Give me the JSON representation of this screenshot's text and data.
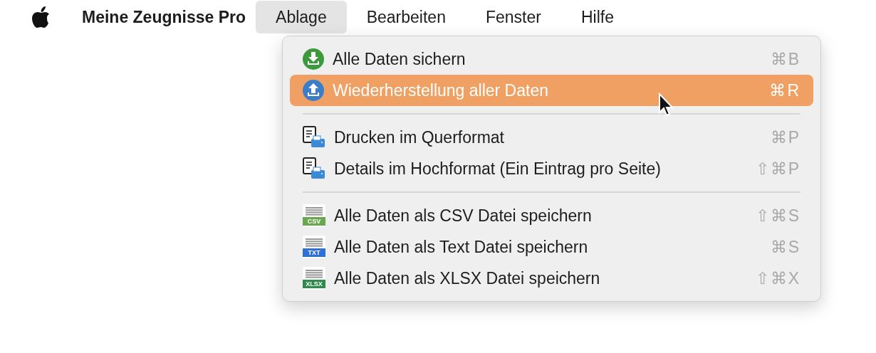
{
  "menu_bar": {
    "app_name": "Meine Zeugnisse Pro",
    "menus": [
      {
        "label": "Ablage",
        "selected": true
      },
      {
        "label": "Bearbeiten",
        "selected": false
      },
      {
        "label": "Fenster",
        "selected": false
      },
      {
        "label": "Hilfe",
        "selected": false
      }
    ]
  },
  "dropdown": {
    "items": [
      {
        "kind": "item",
        "label": "Alle Daten sichern",
        "shortcut": "⌘B",
        "selected": false
      },
      {
        "kind": "item",
        "label": "Wiederherstellung aller Daten",
        "shortcut": "⌘R",
        "selected": true
      },
      {
        "kind": "separator"
      },
      {
        "kind": "item",
        "label": "Drucken im Querformat",
        "shortcut": "⌘P",
        "selected": false
      },
      {
        "kind": "item",
        "label": "Details im Hochformat (Ein Eintrag pro Seite)",
        "shortcut": "⇧⌘P",
        "selected": false
      },
      {
        "kind": "separator"
      },
      {
        "kind": "item",
        "badge": "CSV",
        "label": "Alle Daten als CSV Datei speichern",
        "shortcut": "⇧⌘S",
        "selected": false
      },
      {
        "kind": "item",
        "badge": "TXT",
        "label": "Alle Daten als Text Datei speichern",
        "shortcut": "⌘S",
        "selected": false
      },
      {
        "kind": "item",
        "badge": "XLSX",
        "label": "Alle Daten als XLSX Datei speichern",
        "shortcut": "⇧⌘X",
        "selected": false
      }
    ]
  }
}
